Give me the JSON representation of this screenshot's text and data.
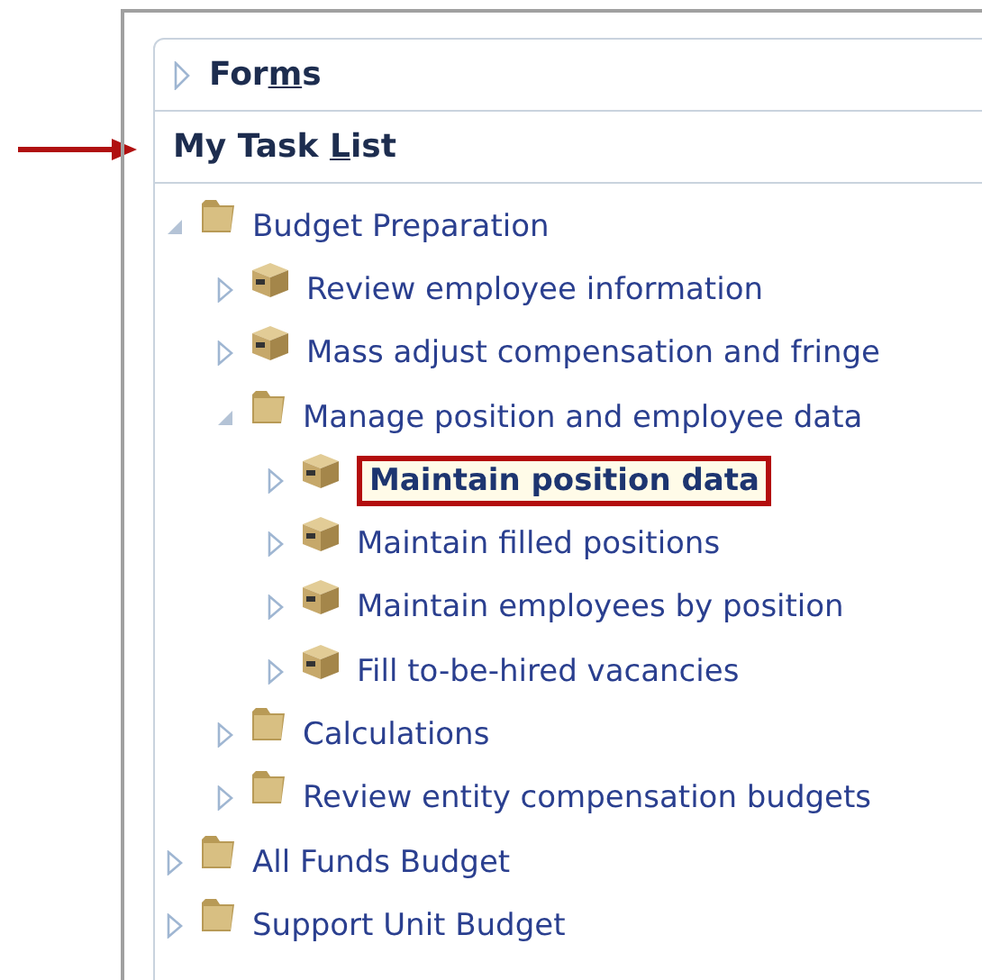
{
  "sections": [
    {
      "label": {
        "before": "For",
        "key": "m",
        "after": "s"
      },
      "expanded": false
    },
    {
      "label": {
        "before": "My Task ",
        "key": "L",
        "after": "ist"
      },
      "expanded": true
    }
  ],
  "tree": [
    {
      "kind": "folder",
      "label": "Budget Preparation",
      "expanded": true,
      "selected": false,
      "children": [
        {
          "kind": "task",
          "label": "Review employee information",
          "expanded": false,
          "selected": false
        },
        {
          "kind": "task",
          "label": "Mass adjust compensation and fringe",
          "expanded": false,
          "selected": false
        },
        {
          "kind": "folder",
          "label": "Manage position and employee data",
          "expanded": true,
          "selected": false,
          "children": [
            {
              "kind": "task",
              "label": "Maintain position data",
              "expanded": false,
              "selected": true
            },
            {
              "kind": "task",
              "label": "Maintain filled positions",
              "expanded": false,
              "selected": false
            },
            {
              "kind": "task",
              "label": "Maintain employees by position",
              "expanded": false,
              "selected": false
            },
            {
              "kind": "task",
              "label": "Fill to-be-hired vacancies",
              "expanded": false,
              "selected": false
            }
          ]
        },
        {
          "kind": "folder",
          "label": "Calculations",
          "expanded": false,
          "selected": false
        },
        {
          "kind": "folder",
          "label": "Review entity compensation budgets",
          "expanded": false,
          "selected": false
        }
      ]
    },
    {
      "kind": "folder",
      "label": "All Funds Budget",
      "expanded": false,
      "selected": false
    },
    {
      "kind": "folder",
      "label": "Support Unit Budget",
      "expanded": false,
      "selected": false
    }
  ]
}
